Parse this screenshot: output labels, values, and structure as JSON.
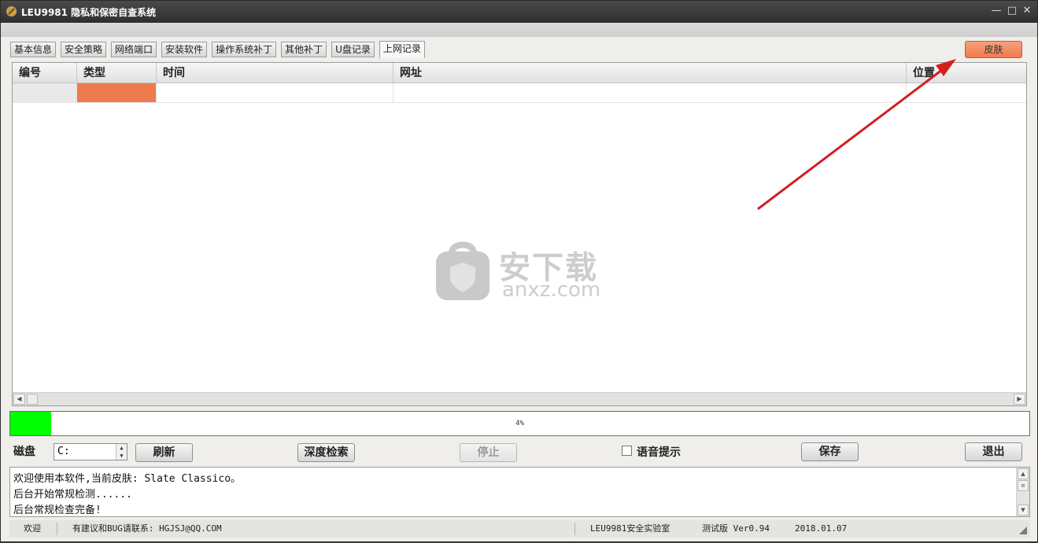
{
  "window": {
    "title": "LEU9981 隐私和保密自查系统"
  },
  "title_buttons": {
    "minimize": "—",
    "maximize": "□",
    "close": "✕"
  },
  "tabs": [
    {
      "label": "基本信息"
    },
    {
      "label": "安全策略"
    },
    {
      "label": "网络端口"
    },
    {
      "label": "安装软件"
    },
    {
      "label": "操作系统补丁"
    },
    {
      "label": "其他补丁"
    },
    {
      "label": "U盘记录"
    },
    {
      "label": "上网记录"
    }
  ],
  "active_tab": "上网记录",
  "skin_button": {
    "label": "皮肤",
    "color": "#ef7a4e"
  },
  "grid": {
    "columns": [
      "编号",
      "类型",
      "时间",
      "网址",
      "位置"
    ],
    "rows": [
      [
        "",
        "",
        "",
        "",
        ""
      ]
    ],
    "highlight_color": "#ef7a4e"
  },
  "progress": {
    "percent_text": "4%",
    "value": 0.04,
    "color": "#00ff00"
  },
  "controls": {
    "disk_label": "磁盘",
    "disk_value": "C:",
    "refresh_label": "刷新",
    "deep_search_label": "深度检索",
    "stop_label": "停止",
    "voice_label": "语音提示",
    "save_label": "保存",
    "exit_label": "退出"
  },
  "log": {
    "lines": [
      "欢迎使用本软件,当前皮肤: Slate Classico。",
      "后台开始常规检测......",
      "后台常规检查完备!"
    ]
  },
  "status": {
    "welcome": "欢迎",
    "contact": "有建议和BUG请联系: HGJSJ@QQ.COM",
    "lab": "LEU9981安全实验室",
    "version": "测试版 Ver0.94",
    "date": "2018.01.07"
  },
  "watermark": {
    "text_cn": "安下载",
    "text_en": "anxz.com"
  }
}
